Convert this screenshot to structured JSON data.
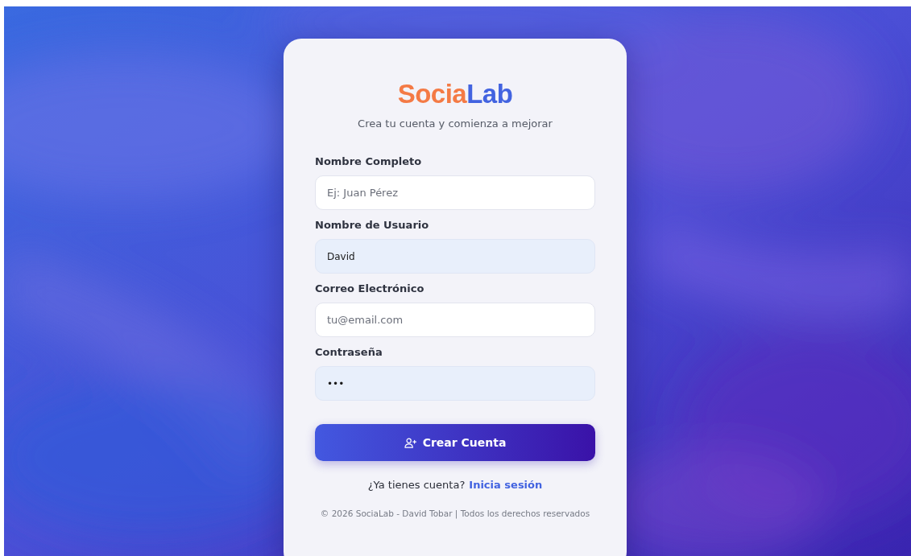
{
  "logo": {
    "part_1": "Socia",
    "part_2": "Lab"
  },
  "subtitle": "Crea tu cuenta y comienza a mejorar",
  "fields": [
    {
      "label": "Nombre Completo",
      "placeholder": "Ej: Juan Pérez",
      "autofilled": false
    },
    {
      "label": "Nombre de Usuario",
      "value": "David",
      "autofilled": true
    },
    {
      "label": "Correo Electrónico",
      "placeholder": "tu@email.com",
      "autofilled": false
    },
    {
      "label": "Contraseña",
      "value": "•••",
      "autofilled": true
    }
  ],
  "submit_button": "Crear Cuenta",
  "login_prompt": {
    "text": "¿Ya tienes cuenta?",
    "link": "Inicia sesión"
  },
  "footer": "© 2026 SociaLab - David Tobar | Todos los derechos reservados"
}
